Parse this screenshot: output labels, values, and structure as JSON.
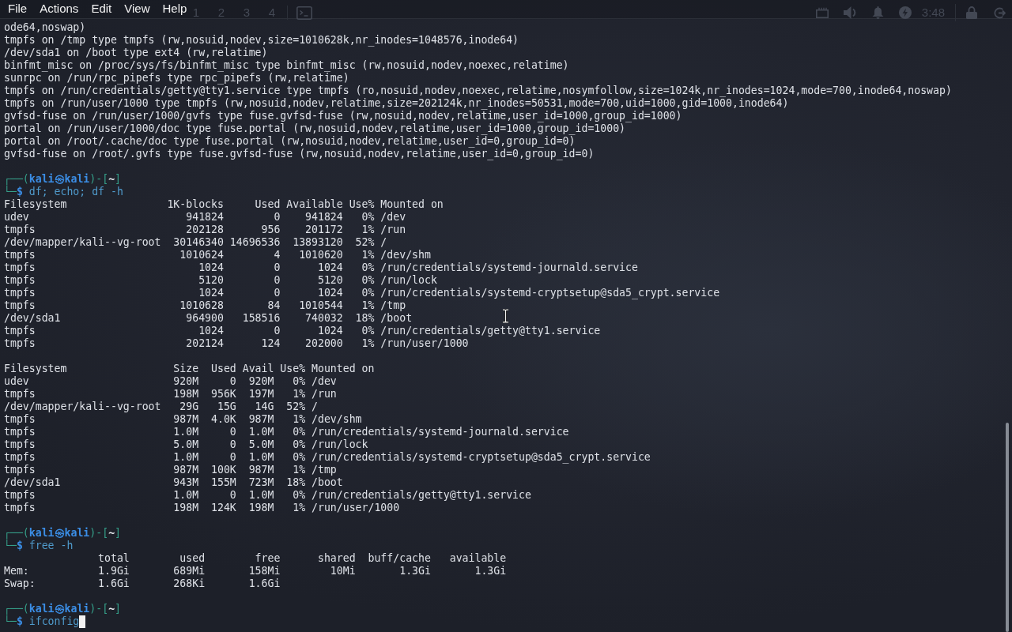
{
  "menu_bar": {
    "items": [
      "File",
      "Actions",
      "Edit",
      "View",
      "Help"
    ]
  },
  "panel": {
    "workspaces": [
      "1",
      "2",
      "3",
      "4"
    ],
    "clock": "3:48"
  },
  "terminal": {
    "lines": [
      {
        "kind": "output",
        "text": "ode64,noswap)"
      },
      {
        "kind": "output",
        "text": "tmpfs on /tmp type tmpfs (rw,nosuid,nodev,size=1010628k,nr_inodes=1048576,inode64)"
      },
      {
        "kind": "output",
        "text": "/dev/sda1 on /boot type ext4 (rw,relatime)"
      },
      {
        "kind": "output",
        "text": "binfmt_misc on /proc/sys/fs/binfmt_misc type binfmt_misc (rw,nosuid,nodev,noexec,relatime)"
      },
      {
        "kind": "output",
        "text": "sunrpc on /run/rpc_pipefs type rpc_pipefs (rw,relatime)"
      },
      {
        "kind": "output",
        "text": "tmpfs on /run/credentials/getty@tty1.service type tmpfs (ro,nosuid,nodev,noexec,relatime,nosymfollow,size=1024k,nr_inodes=1024,mode=700,inode64,noswap)"
      },
      {
        "kind": "output",
        "text": "tmpfs on /run/user/1000 type tmpfs (rw,nosuid,nodev,relatime,size=202124k,nr_inodes=50531,mode=700,uid=1000,gid=1000,inode64)"
      },
      {
        "kind": "output",
        "text": "gvfsd-fuse on /run/user/1000/gvfs type fuse.gvfsd-fuse (rw,nosuid,nodev,relatime,user_id=1000,group_id=1000)"
      },
      {
        "kind": "output",
        "text": "portal on /run/user/1000/doc type fuse.portal (rw,nosuid,nodev,relatime,user_id=1000,group_id=1000)"
      },
      {
        "kind": "output",
        "text": "portal on /root/.cache/doc type fuse.portal (rw,nosuid,nodev,relatime,user_id=0,group_id=0)"
      },
      {
        "kind": "output",
        "text": "gvfsd-fuse on /root/.gvfs type fuse.gvfsd-fuse (rw,nosuid,nodev,relatime,user_id=0,group_id=0)"
      },
      {
        "kind": "blank"
      },
      {
        "kind": "prompt",
        "frame_open": "┌──(",
        "user": "kali㉿kali",
        "frame_mid": ")-[",
        "dir": "~",
        "frame_close": "]"
      },
      {
        "kind": "command",
        "lead": "└─",
        "symbol": "$",
        "text": "df; echo; df -h",
        "cursor": false
      },
      {
        "kind": "output",
        "text": "Filesystem                1K-blocks     Used Available Use% Mounted on"
      },
      {
        "kind": "output",
        "text": "udev                         941824        0    941824   0% /dev"
      },
      {
        "kind": "output",
        "text": "tmpfs                        202128      956    201172   1% /run"
      },
      {
        "kind": "output",
        "text": "/dev/mapper/kali--vg-root  30146340 14696536  13893120  52% /"
      },
      {
        "kind": "output",
        "text": "tmpfs                       1010624        4   1010620   1% /dev/shm"
      },
      {
        "kind": "output",
        "text": "tmpfs                          1024        0      1024   0% /run/credentials/systemd-journald.service"
      },
      {
        "kind": "output",
        "text": "tmpfs                          5120        0      5120   0% /run/lock"
      },
      {
        "kind": "output",
        "text": "tmpfs                          1024        0      1024   0% /run/credentials/systemd-cryptsetup@sda5_crypt.service"
      },
      {
        "kind": "output",
        "text": "tmpfs                       1010628       84   1010544   1% /tmp"
      },
      {
        "kind": "output",
        "text": "/dev/sda1                    964900   158516    740032  18% /boot"
      },
      {
        "kind": "output",
        "text": "tmpfs                          1024        0      1024   0% /run/credentials/getty@tty1.service"
      },
      {
        "kind": "output",
        "text": "tmpfs                        202124      124    202000   1% /run/user/1000"
      },
      {
        "kind": "blank"
      },
      {
        "kind": "output",
        "text": "Filesystem                 Size  Used Avail Use% Mounted on"
      },
      {
        "kind": "output",
        "text": "udev                       920M     0  920M   0% /dev"
      },
      {
        "kind": "output",
        "text": "tmpfs                      198M  956K  197M   1% /run"
      },
      {
        "kind": "output",
        "text": "/dev/mapper/kali--vg-root   29G   15G   14G  52% /"
      },
      {
        "kind": "output",
        "text": "tmpfs                      987M  4.0K  987M   1% /dev/shm"
      },
      {
        "kind": "output",
        "text": "tmpfs                      1.0M     0  1.0M   0% /run/credentials/systemd-journald.service"
      },
      {
        "kind": "output",
        "text": "tmpfs                      5.0M     0  5.0M   0% /run/lock"
      },
      {
        "kind": "output",
        "text": "tmpfs                      1.0M     0  1.0M   0% /run/credentials/systemd-cryptsetup@sda5_crypt.service"
      },
      {
        "kind": "output",
        "text": "tmpfs                      987M  100K  987M   1% /tmp"
      },
      {
        "kind": "output",
        "text": "/dev/sda1                  943M  155M  723M  18% /boot"
      },
      {
        "kind": "output",
        "text": "tmpfs                      1.0M     0  1.0M   0% /run/credentials/getty@tty1.service"
      },
      {
        "kind": "output",
        "text": "tmpfs                      198M  124K  198M   1% /run/user/1000"
      },
      {
        "kind": "blank"
      },
      {
        "kind": "prompt",
        "frame_open": "┌──(",
        "user": "kali㉿kali",
        "frame_mid": ")-[",
        "dir": "~",
        "frame_close": "]"
      },
      {
        "kind": "command",
        "lead": "└─",
        "symbol": "$",
        "text": "free -h",
        "cursor": false
      },
      {
        "kind": "output",
        "text": "               total        used        free      shared  buff/cache   available"
      },
      {
        "kind": "output",
        "text": "Mem:           1.9Gi       689Mi       158Mi        10Mi       1.3Gi       1.3Gi"
      },
      {
        "kind": "output",
        "text": "Swap:          1.6Gi       268Ki       1.6Gi"
      },
      {
        "kind": "blank"
      },
      {
        "kind": "prompt",
        "frame_open": "┌──(",
        "user": "kali㉿kali",
        "frame_mid": ")-[",
        "dir": "~",
        "frame_close": "]"
      },
      {
        "kind": "command",
        "lead": "└─",
        "symbol": "$",
        "text": "ifconfig",
        "cursor": true
      }
    ]
  }
}
